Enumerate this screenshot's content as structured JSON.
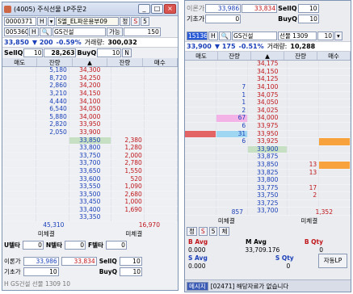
{
  "w1": {
    "title": "(4005) 주식선물 LP주문2",
    "account": "0000371",
    "acc_type": "H",
    "acc_name": "S엘_EL파운용부09",
    "pw": "정",
    "btn_s": "S",
    "btn_5": "5",
    "code": "005360",
    "code_h": "H",
    "stock_name": "GS건설",
    "unit_label": "가능",
    "unit_value": "150",
    "price": "33,850",
    "change": "▼ 200",
    "change_pct": "-0.59%",
    "volume_label": "거래량:",
    "volume": "300,032",
    "sell_q_label": "SellQ",
    "sell_q": "10",
    "sell_q_total": "28,263",
    "buy_q_label": "BuyQ",
    "buy_q": "10",
    "n_label": "N",
    "headers": [
      "매도",
      "잔량",
      "▲",
      "잔량",
      "매수"
    ],
    "rows": [
      [
        "",
        "5,180",
        "34,300",
        "",
        ""
      ],
      [
        "",
        "8,720",
        "34,250",
        "",
        ""
      ],
      [
        "",
        "2,860",
        "34,200",
        "",
        ""
      ],
      [
        "",
        "3,210",
        "34,150",
        "",
        ""
      ],
      [
        "",
        "4,440",
        "34,100",
        "",
        ""
      ],
      [
        "",
        "6,540",
        "34,050",
        "",
        ""
      ],
      [
        "",
        "5,880",
        "34,000",
        "",
        ""
      ],
      [
        "",
        "2,820",
        "33,950",
        "",
        ""
      ],
      [
        "",
        "2,050",
        "33,900",
        "",
        ""
      ],
      [
        "",
        "",
        "33,850",
        "2,380",
        ""
      ],
      [
        "",
        "",
        "33,800",
        "1,280",
        ""
      ],
      [
        "",
        "",
        "33,750",
        "2,000",
        ""
      ],
      [
        "",
        "",
        "33,700",
        "2,780",
        ""
      ],
      [
        "",
        "",
        "33,650",
        "1,550",
        ""
      ],
      [
        "",
        "",
        "33,600",
        "520",
        ""
      ],
      [
        "",
        "",
        "33,550",
        "1,090",
        ""
      ],
      [
        "",
        "",
        "33,500",
        "2,680",
        ""
      ],
      [
        "",
        "",
        "33,450",
        "1,000",
        ""
      ],
      [
        "",
        "",
        "33,400",
        "1,690",
        ""
      ],
      [
        "",
        "",
        "33,350",
        "",
        ""
      ]
    ],
    "sum_sell": "45,310",
    "sum_buy": "16,970",
    "unfilled_label": "미체결",
    "unfilled2": "미체결",
    "utta": "U텔타",
    "utta_v": "0",
    "ntta": "N텔타",
    "ntta_v": "0",
    "ftta": "F텔타",
    "ftta_v": "0",
    "bottom1_label": "이론가",
    "bottom1_v1": "33,986",
    "bottom1_v2": "33,834",
    "bottom1_sellq": "SellQ",
    "bottom1_sellq_v": "10",
    "bottom2_label": "기초가",
    "bottom2_v1": "10",
    "bottom2_buyq": "BuyQ",
    "bottom2_buyq_v": "10",
    "last_row": "H  GS건설   선물 1309  10"
  },
  "w2": {
    "top1_label": "이론가",
    "top1_v1": "33,986",
    "top1_v2": "33,834",
    "top1_sellq": "SellQ",
    "top1_sellq_v": "10",
    "top2_label": "기초가",
    "top2_v1": "0",
    "top2_buyq": "BuyQ",
    "top2_buyq_v": "10",
    "code": "15136",
    "code_h": "H",
    "stock_name": "GS건설",
    "futures": "선물 1309",
    "qty": "10",
    "price": "33,900",
    "change": "▼ 175",
    "change_pct": "-0.51%",
    "volume_label": "거래량:",
    "volume": "10,288",
    "headers": [
      "매도",
      "잔량",
      "▲",
      "잔량",
      "매수"
    ],
    "rows": [
      [
        "",
        "",
        "34,175",
        "",
        ""
      ],
      [
        "",
        "",
        "34,150",
        "",
        ""
      ],
      [
        "",
        "",
        "34,125",
        "",
        ""
      ],
      [
        "",
        "7",
        "34,100",
        "",
        ""
      ],
      [
        "",
        "1",
        "34,075",
        "",
        ""
      ],
      [
        "",
        "1",
        "34,050",
        "",
        ""
      ],
      [
        "",
        "2",
        "34,025",
        "",
        ""
      ],
      [
        "",
        "67",
        "34,000",
        "",
        ""
      ],
      [
        "",
        "6",
        "33,975",
        "",
        ""
      ],
      [
        "",
        "31",
        "33,950",
        "",
        ""
      ],
      [
        "",
        "6",
        "33,925",
        "",
        ""
      ],
      [
        "",
        "",
        "33,900",
        "",
        ""
      ],
      [
        "",
        "",
        "33,875",
        "",
        ""
      ],
      [
        "",
        "",
        "33,850",
        "13",
        ""
      ],
      [
        "",
        "",
        "33,825",
        "13",
        ""
      ],
      [
        "",
        "",
        "33,800",
        "",
        ""
      ],
      [
        "",
        "",
        "33,775",
        "17",
        ""
      ],
      [
        "",
        "",
        "33,750",
        "2",
        ""
      ],
      [
        "",
        "",
        "33,725",
        "",
        ""
      ],
      [
        "",
        "",
        "33,700",
        "",
        ""
      ]
    ],
    "sum_sell": "857",
    "sum_buy": "1,352",
    "unfilled_label": "미체결",
    "unfilled2": "미체결",
    "pw": "정",
    "btn_s": "S",
    "btn_5": "5",
    "btn_che": "체",
    "b_avg": "B Avg",
    "m_avg": "M Avg",
    "b_qty": "B Qty",
    "b_avg_v": "0.000",
    "m_avg_v": "33,709.176",
    "b_qty_v": "0",
    "s_avg": "S Avg",
    "s_qty": "S Qty",
    "s_avg_v": "0.000",
    "s_qty_v": "0",
    "auto_lp": "자동LP",
    "msg_label": "메시지",
    "msg": "[02471] 해당자료가 없습니다"
  }
}
